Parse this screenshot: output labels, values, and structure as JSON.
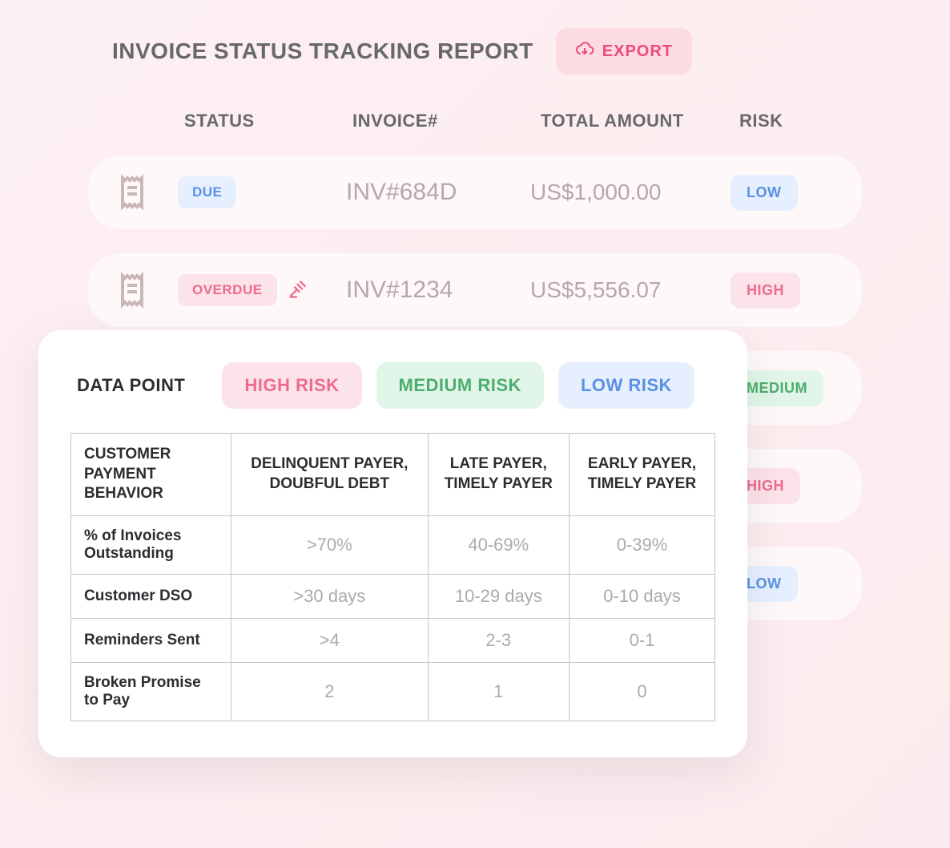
{
  "header": {
    "title": "INVOICE STATUS TRACKING REPORT",
    "export_label": "EXPORT"
  },
  "columns": {
    "status": "STATUS",
    "invoice": "INVOICE#",
    "amount": "TOTAL AMOUNT",
    "risk": "RISK"
  },
  "rows": [
    {
      "status": "DUE",
      "status_class": "status-due",
      "invoice": "INV#684D",
      "amount": "US$1,000.00",
      "risk": "LOW",
      "risk_class": "risk-low",
      "overdue_icon": false
    },
    {
      "status": "OVERDUE",
      "status_class": "status-overdue",
      "invoice": "INV#1234",
      "amount": "US$5,556.07",
      "risk": "HIGH",
      "risk_class": "risk-high",
      "overdue_icon": true
    },
    {
      "status": "",
      "status_class": "",
      "invoice": "",
      "amount": "",
      "risk": "MEDIUM",
      "risk_class": "risk-medium",
      "overdue_icon": false
    },
    {
      "status": "",
      "status_class": "",
      "invoice": "",
      "amount": "",
      "risk": "HIGH",
      "risk_class": "risk-high",
      "overdue_icon": false
    },
    {
      "status": "",
      "status_class": "",
      "invoice": "",
      "amount": "",
      "risk": "LOW",
      "risk_class": "risk-low",
      "overdue_icon": false
    }
  ],
  "popup": {
    "tabs": {
      "data": "DATA POINT",
      "high": "HIGH RISK",
      "medium": "MEDIUM RISK",
      "low": "LOW RISK"
    },
    "headers": {
      "behavior": "CUSTOMER PAYMENT BEHAVIOR",
      "high": "DELINQUENT PAYER, DOUBFUL DEBT",
      "medium": "LATE PAYER, TIMELY PAYER",
      "low": "EARLY PAYER, TIMELY PAYER"
    },
    "rows": [
      {
        "label": "% of Invoices Outstanding",
        "high": ">70%",
        "medium": "40-69%",
        "low": "0-39%"
      },
      {
        "label": "Customer DSO",
        "high": ">30 days",
        "medium": "10-29 days",
        "low": "0-10 days"
      },
      {
        "label": "Reminders Sent",
        "high": ">4",
        "medium": "2-3",
        "low": "0-1"
      },
      {
        "label": "Broken Promise to Pay",
        "high": "2",
        "medium": "1",
        "low": "0"
      }
    ]
  }
}
